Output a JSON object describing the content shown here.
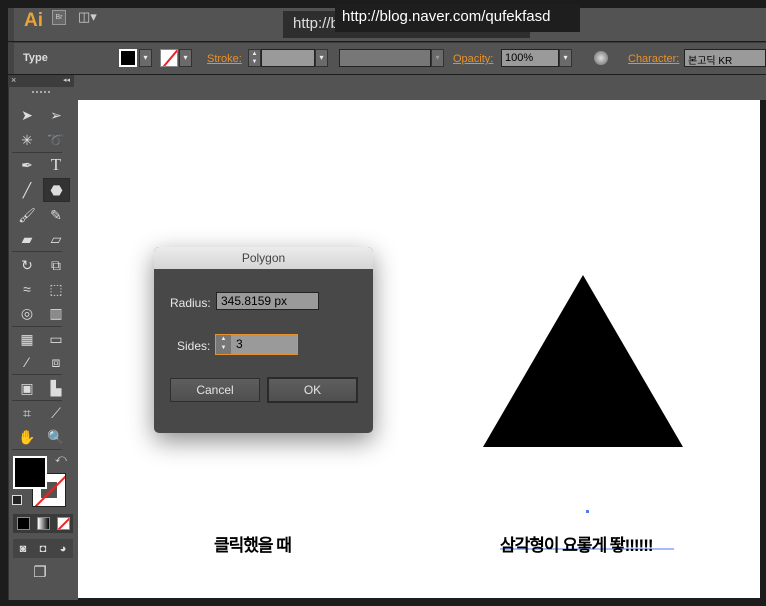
{
  "app": {
    "logo": "Ai",
    "bridge": "Br",
    "workspace_icon": "workspace-switcher-icon"
  },
  "watermark": {
    "back": "http://blog.naver.com/qufekfasd",
    "front": "http://blog.naver.com/qufekfasd"
  },
  "control_bar": {
    "mode": "Type",
    "stroke_label": "Stroke:",
    "opacity_label": "Opacity:",
    "opacity_value": "100%",
    "character_label": "Character:",
    "font_value": "본고딕 KR"
  },
  "toolbox": {
    "close": "×",
    "collapse": "◂◂"
  },
  "dialog": {
    "title": "Polygon",
    "radius_label": "Radius:",
    "radius_value": "345.8159 px",
    "sides_label": "Sides:",
    "sides_value": "3",
    "cancel": "Cancel",
    "ok": "OK"
  },
  "canvas": {
    "caption_left": "클릭했을 때",
    "caption_right": "삼각형이 요롷게 뙇!!!!!!"
  },
  "colors": {
    "accent": "#e8912a",
    "fill": "#000000"
  }
}
